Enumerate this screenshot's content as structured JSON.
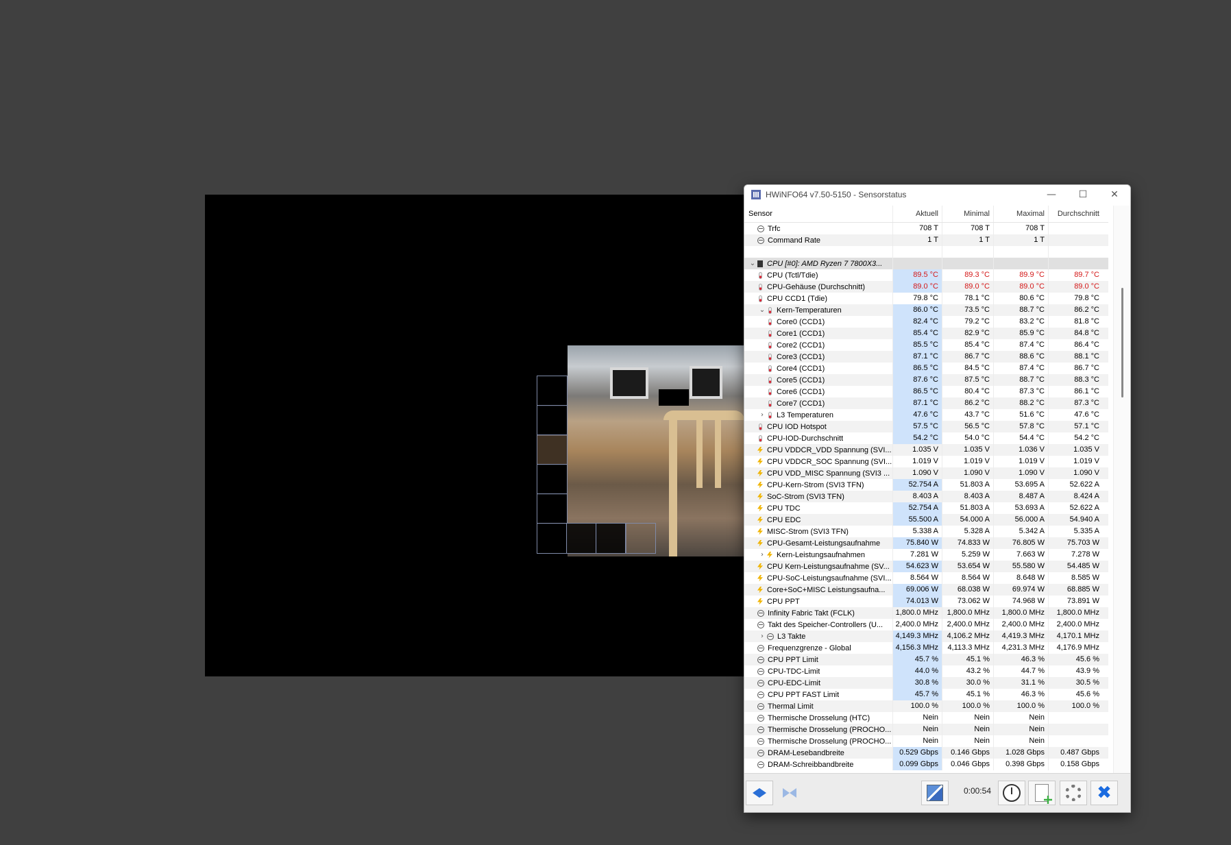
{
  "window": {
    "title": "HWiNFO64 v7.50-5150 - Sensorstatus",
    "controls": {
      "minimize": "—",
      "maximize": "☐",
      "close": "✕"
    }
  },
  "table": {
    "headers": [
      "Sensor",
      "Aktuell",
      "Minimal",
      "Maximal",
      "Durchschnitt"
    ],
    "rows": [
      {
        "label": "Trfc",
        "icon": "clock",
        "indent": 1,
        "values": [
          "708 T",
          "708 T",
          "708 T",
          ""
        ]
      },
      {
        "label": "Command Rate",
        "icon": "clock",
        "indent": 1,
        "values": [
          "1 T",
          "1 T",
          "1 T",
          ""
        ]
      },
      {
        "label": "",
        "icon": "",
        "indent": 0,
        "values": [
          "",
          "",
          "",
          ""
        ],
        "blank": true
      },
      {
        "label": "CPU [#0]: AMD Ryzen 7 7800X3...",
        "icon": "cpu",
        "indent": 0,
        "expander": "v",
        "group": true,
        "values": [
          "",
          "",
          "",
          ""
        ]
      },
      {
        "label": "CPU (Tctl/Tdie)",
        "icon": "therm",
        "indent": 1,
        "values": [
          "89.5 °C",
          "89.3 °C",
          "89.9 °C",
          "89.7 °C"
        ],
        "red": true,
        "hl": true
      },
      {
        "label": "CPU-Gehäuse (Durchschnitt)",
        "icon": "therm",
        "indent": 1,
        "values": [
          "89.0 °C",
          "89.0 °C",
          "89.0 °C",
          "89.0 °C"
        ],
        "red": true,
        "hl": true
      },
      {
        "label": "CPU CCD1 (Tdie)",
        "icon": "therm",
        "indent": 1,
        "values": [
          "79.8 °C",
          "78.1 °C",
          "80.6 °C",
          "79.8 °C"
        ]
      },
      {
        "label": "Kern-Temperaturen",
        "icon": "therm",
        "indent": 2,
        "expander": "v",
        "values": [
          "86.0 °C",
          "73.5 °C",
          "88.7 °C",
          "86.2 °C"
        ],
        "hl": true
      },
      {
        "label": "Core0 (CCD1)",
        "icon": "therm",
        "indent": 2,
        "values": [
          "82.4 °C",
          "79.2 °C",
          "83.2 °C",
          "81.8 °C"
        ],
        "hl": true
      },
      {
        "label": "Core1 (CCD1)",
        "icon": "therm",
        "indent": 2,
        "values": [
          "85.4 °C",
          "82.9 °C",
          "85.9 °C",
          "84.8 °C"
        ],
        "hl": true
      },
      {
        "label": "Core2 (CCD1)",
        "icon": "therm",
        "indent": 2,
        "values": [
          "85.5 °C",
          "85.4 °C",
          "87.4 °C",
          "86.4 °C"
        ],
        "hl": true
      },
      {
        "label": "Core3 (CCD1)",
        "icon": "therm",
        "indent": 2,
        "values": [
          "87.1 °C",
          "86.7 °C",
          "88.6 °C",
          "88.1 °C"
        ],
        "hl": true
      },
      {
        "label": "Core4 (CCD1)",
        "icon": "therm",
        "indent": 2,
        "values": [
          "86.5 °C",
          "84.5 °C",
          "87.4 °C",
          "86.7 °C"
        ],
        "hl": true
      },
      {
        "label": "Core5 (CCD1)",
        "icon": "therm",
        "indent": 2,
        "values": [
          "87.6 °C",
          "87.5 °C",
          "88.7 °C",
          "88.3 °C"
        ],
        "hl": true
      },
      {
        "label": "Core6 (CCD1)",
        "icon": "therm",
        "indent": 2,
        "values": [
          "86.5 °C",
          "80.4 °C",
          "87.3 °C",
          "86.1 °C"
        ],
        "hl": true
      },
      {
        "label": "Core7 (CCD1)",
        "icon": "therm",
        "indent": 2,
        "values": [
          "87.1 °C",
          "86.2 °C",
          "88.2 °C",
          "87.3 °C"
        ],
        "hl": true
      },
      {
        "label": "L3 Temperaturen",
        "icon": "therm",
        "indent": 2,
        "expander": ">",
        "values": [
          "47.6 °C",
          "43.7 °C",
          "51.6 °C",
          "47.6 °C"
        ],
        "hl": true
      },
      {
        "label": "CPU IOD Hotspot",
        "icon": "therm",
        "indent": 1,
        "values": [
          "57.5 °C",
          "56.5 °C",
          "57.8 °C",
          "57.1 °C"
        ],
        "hl": true
      },
      {
        "label": "CPU-IOD-Durchschnitt",
        "icon": "therm",
        "indent": 1,
        "values": [
          "54.2 °C",
          "54.0 °C",
          "54.4 °C",
          "54.2 °C"
        ],
        "hl": true
      },
      {
        "label": "CPU VDDCR_VDD Spannung (SVI...",
        "icon": "bolt",
        "indent": 1,
        "values": [
          "1.035 V",
          "1.035 V",
          "1.036 V",
          "1.035 V"
        ]
      },
      {
        "label": "CPU VDDCR_SOC Spannung (SVI...",
        "icon": "bolt",
        "indent": 1,
        "values": [
          "1.019 V",
          "1.019 V",
          "1.019 V",
          "1.019 V"
        ]
      },
      {
        "label": "CPU VDD_MISC Spannung (SVI3 ...",
        "icon": "bolt",
        "indent": 1,
        "values": [
          "1.090 V",
          "1.090 V",
          "1.090 V",
          "1.090 V"
        ]
      },
      {
        "label": "CPU-Kern-Strom (SVI3 TFN)",
        "icon": "bolt",
        "indent": 1,
        "values": [
          "52.754 A",
          "51.803 A",
          "53.695 A",
          "52.622 A"
        ],
        "hl": true
      },
      {
        "label": "SoC-Strom (SVI3 TFN)",
        "icon": "bolt",
        "indent": 1,
        "values": [
          "8.403 A",
          "8.403 A",
          "8.487 A",
          "8.424 A"
        ]
      },
      {
        "label": "CPU TDC",
        "icon": "bolt",
        "indent": 1,
        "values": [
          "52.754 A",
          "51.803 A",
          "53.693 A",
          "52.622 A"
        ],
        "hl": true
      },
      {
        "label": "CPU EDC",
        "icon": "bolt",
        "indent": 1,
        "values": [
          "55.500 A",
          "54.000 A",
          "56.000 A",
          "54.940 A"
        ],
        "hl": true
      },
      {
        "label": "MISC-Strom (SVI3 TFN)",
        "icon": "bolt",
        "indent": 1,
        "values": [
          "5.338 A",
          "5.328 A",
          "5.342 A",
          "5.335 A"
        ]
      },
      {
        "label": "CPU-Gesamt-Leistungsaufnahme",
        "icon": "bolt",
        "indent": 1,
        "values": [
          "75.840 W",
          "74.833 W",
          "76.805 W",
          "75.703 W"
        ],
        "hl": true
      },
      {
        "label": "Kern-Leistungsaufnahmen",
        "icon": "bolt",
        "indent": 2,
        "expander": ">",
        "values": [
          "7.281 W",
          "5.259 W",
          "7.663 W",
          "7.278 W"
        ]
      },
      {
        "label": "CPU Kern-Leistungsaufnahme (SV...",
        "icon": "bolt",
        "indent": 1,
        "values": [
          "54.623 W",
          "53.654 W",
          "55.580 W",
          "54.485 W"
        ],
        "hl": true
      },
      {
        "label": "CPU-SoC-Leistungsaufnahme (SVI...",
        "icon": "bolt",
        "indent": 1,
        "values": [
          "8.564 W",
          "8.564 W",
          "8.648 W",
          "8.585 W"
        ]
      },
      {
        "label": "Core+SoC+MISC Leistungsaufna...",
        "icon": "bolt",
        "indent": 1,
        "values": [
          "69.006 W",
          "68.038 W",
          "69.974 W",
          "68.885 W"
        ],
        "hl": true
      },
      {
        "label": "CPU PPT",
        "icon": "bolt",
        "indent": 1,
        "values": [
          "74.013 W",
          "73.062 W",
          "74.968 W",
          "73.891 W"
        ],
        "hl": true
      },
      {
        "label": "Infinity Fabric Takt (FCLK)",
        "icon": "clock",
        "indent": 1,
        "values": [
          "1,800.0 MHz",
          "1,800.0 MHz",
          "1,800.0 MHz",
          "1,800.0 MHz"
        ]
      },
      {
        "label": "Takt des Speicher-Controllers (U...",
        "icon": "clock",
        "indent": 1,
        "values": [
          "2,400.0 MHz",
          "2,400.0 MHz",
          "2,400.0 MHz",
          "2,400.0 MHz"
        ]
      },
      {
        "label": "L3 Takte",
        "icon": "clock",
        "indent": 2,
        "expander": ">",
        "values": [
          "4,149.3 MHz",
          "4,106.2 MHz",
          "4,419.3 MHz",
          "4,170.1 MHz"
        ],
        "hl": true
      },
      {
        "label": "Frequenzgrenze - Global",
        "icon": "clock",
        "indent": 1,
        "values": [
          "4,156.3 MHz",
          "4,113.3 MHz",
          "4,231.3 MHz",
          "4,176.9 MHz"
        ],
        "hl": true
      },
      {
        "label": "CPU PPT Limit",
        "icon": "clock",
        "indent": 1,
        "values": [
          "45.7 %",
          "45.1 %",
          "46.3 %",
          "45.6 %"
        ],
        "hl": true
      },
      {
        "label": "CPU-TDC-Limit",
        "icon": "clock",
        "indent": 1,
        "values": [
          "44.0 %",
          "43.2 %",
          "44.7 %",
          "43.9 %"
        ],
        "hl": true
      },
      {
        "label": "CPU-EDC-Limit",
        "icon": "clock",
        "indent": 1,
        "values": [
          "30.8 %",
          "30.0 %",
          "31.1 %",
          "30.5 %"
        ],
        "hl": true
      },
      {
        "label": "CPU PPT FAST Limit",
        "icon": "clock",
        "indent": 1,
        "values": [
          "45.7 %",
          "45.1 %",
          "46.3 %",
          "45.6 %"
        ],
        "hl": true
      },
      {
        "label": "Thermal Limit",
        "icon": "clock",
        "indent": 1,
        "values": [
          "100.0 %",
          "100.0 %",
          "100.0 %",
          "100.0 %"
        ]
      },
      {
        "label": "Thermische Drosselung (HTC)",
        "icon": "clock",
        "indent": 1,
        "values": [
          "Nein",
          "Nein",
          "Nein",
          ""
        ]
      },
      {
        "label": "Thermische Drosselung (PROCHO...",
        "icon": "clock",
        "indent": 1,
        "values": [
          "Nein",
          "Nein",
          "Nein",
          ""
        ]
      },
      {
        "label": "Thermische Drosselung (PROCHO...",
        "icon": "clock",
        "indent": 1,
        "values": [
          "Nein",
          "Nein",
          "Nein",
          ""
        ]
      },
      {
        "label": "DRAM-Lesebandbreite",
        "icon": "clock",
        "indent": 1,
        "values": [
          "0.529 Gbps",
          "0.146 Gbps",
          "1.028 Gbps",
          "0.487 Gbps"
        ],
        "hl": true
      },
      {
        "label": "DRAM-Schreibbandbreite",
        "icon": "clock",
        "indent": 1,
        "values": [
          "0.099 Gbps",
          "0.046 Gbps",
          "0.398 Gbps",
          "0.158 Gbps"
        ],
        "hl": true
      }
    ]
  },
  "toolbar": {
    "timer": "0:00:54"
  },
  "colors": {
    "highlight": "#cfe3fb",
    "alarm_red": "#d41818",
    "accent_blue": "#2a6fd6"
  }
}
